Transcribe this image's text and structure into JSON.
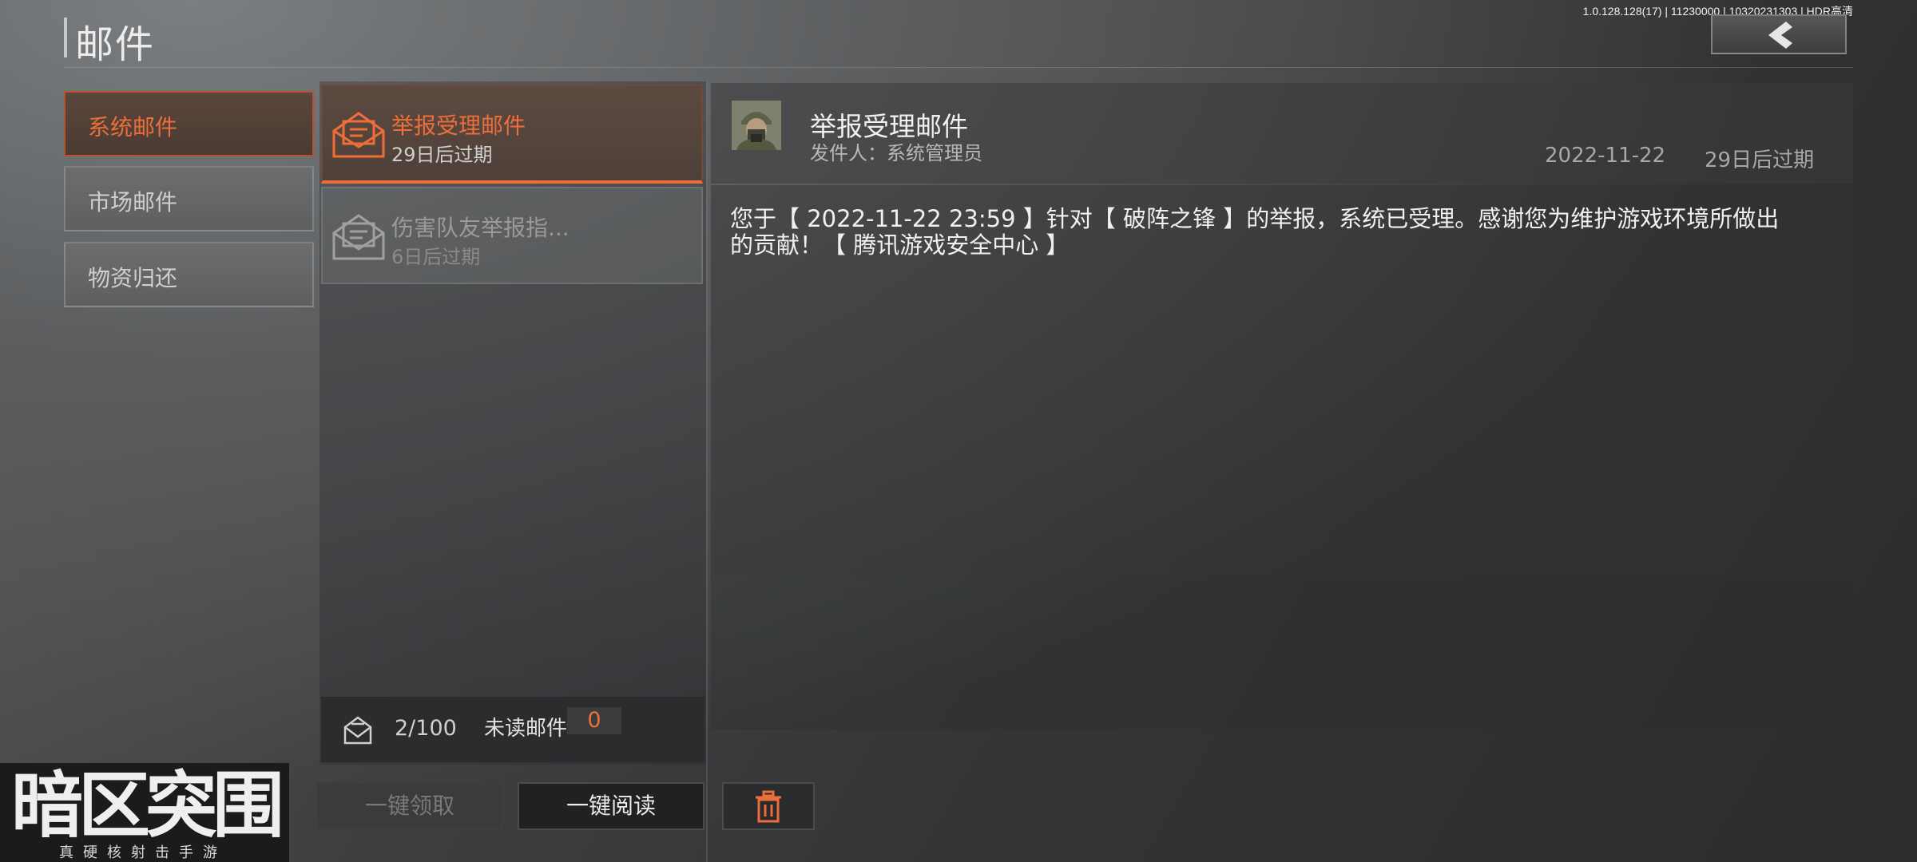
{
  "header": {
    "title": "邮件",
    "version": "1.0.128.128(17) | 11230000 | 10320231303 | HDR高清",
    "back_icon": "chevron-left-icon"
  },
  "categories": [
    {
      "label": "系统邮件",
      "active": true
    },
    {
      "label": "市场邮件",
      "active": false
    },
    {
      "label": "物资归还",
      "active": false
    }
  ],
  "mail_list": [
    {
      "title": "举报受理邮件",
      "expiry": "29日后过期",
      "icon": "envelope-open-icon",
      "active": true
    },
    {
      "title": "伤害队友举报指...",
      "expiry": "6日后过期",
      "icon": "envelope-open-icon",
      "active": false
    }
  ],
  "mailbox": {
    "count": "2/100",
    "unread_label": "未读邮件",
    "unread_count": "0"
  },
  "actions": {
    "claim_all": "一键领取",
    "read_all": "一键阅读",
    "delete_icon": "trash-icon"
  },
  "detail": {
    "title": "举报受理邮件",
    "sender": "发件人：系统管理员",
    "date": "2022-11-22",
    "expiry": "29日后过期",
    "content": "您于【 2022-11-22 23:59 】针对【 破阵之锋 】的举报，系统已受理。感谢您为维护游戏环境所做出的贡献！【 腾讯游戏安全中心 】"
  },
  "logo": {
    "main": "暗区突围",
    "sub": "真硬核射击手游"
  },
  "colors": {
    "accent": "#ee6e3a"
  }
}
